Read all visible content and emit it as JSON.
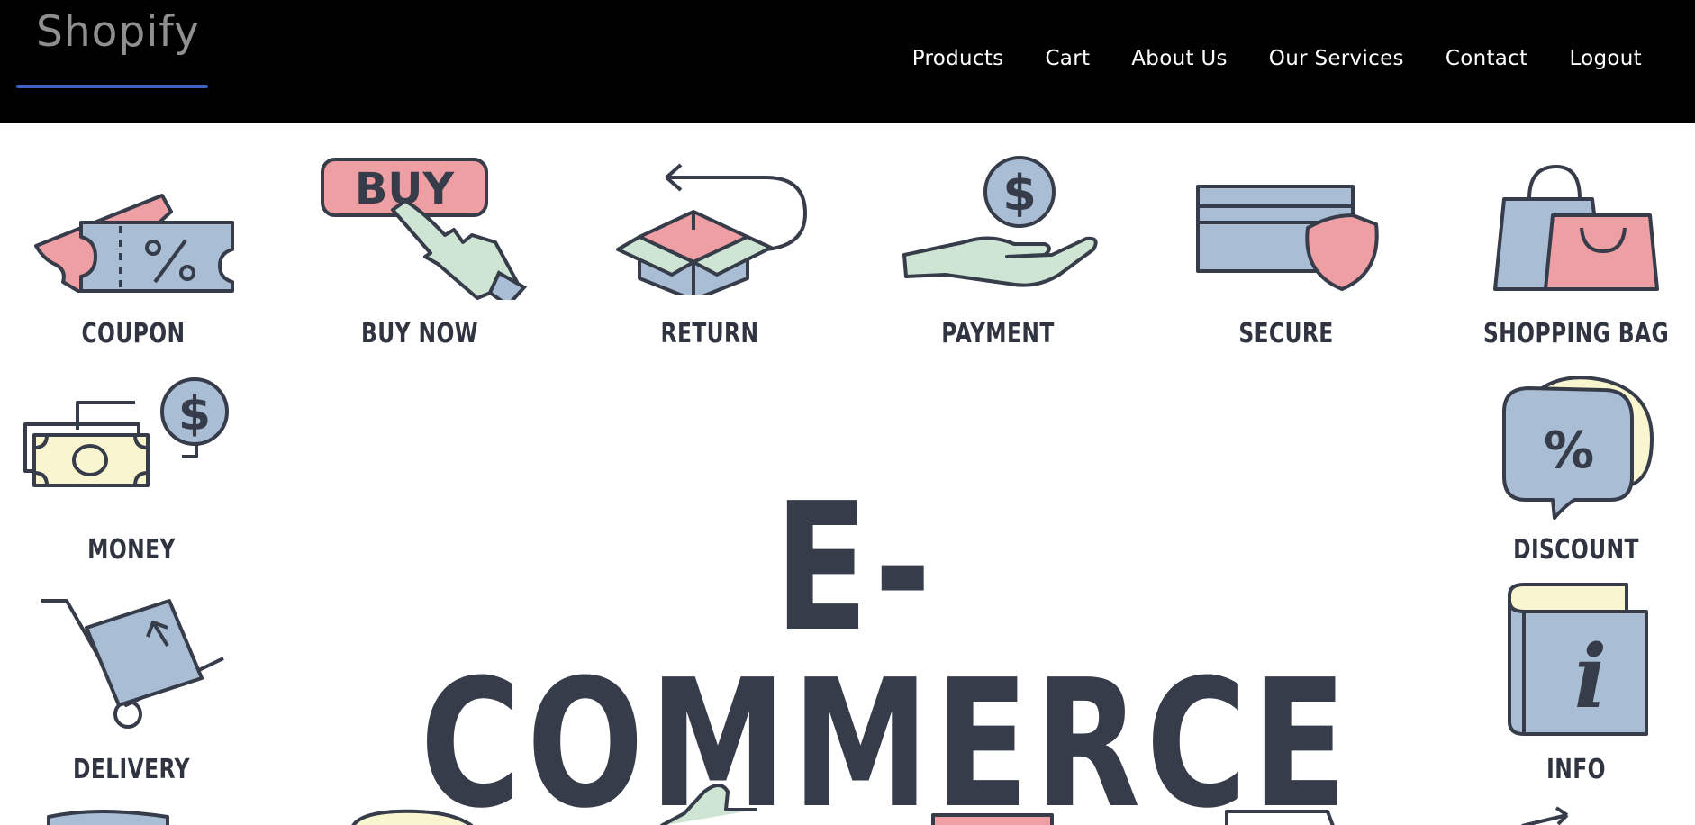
{
  "navbar": {
    "brand": "Shopify",
    "links": [
      {
        "label": "Products"
      },
      {
        "label": "Cart"
      },
      {
        "label": "About Us"
      },
      {
        "label": "Our Services"
      },
      {
        "label": "Contact"
      },
      {
        "label": "Logout"
      }
    ]
  },
  "hero": {
    "headline": "E-COMMERCE",
    "colors": {
      "ink": "#363c49",
      "blue": "#a9bdd4",
      "pink": "#ee9fa3",
      "green": "#cfe5d4",
      "cream": "#f8f5cf",
      "accent_underline": "#3f62c9"
    },
    "icons": [
      {
        "label": "COUPON",
        "icon": "coupon-icon"
      },
      {
        "label": "BUY NOW",
        "icon": "buy-now-icon",
        "button_text": "BUY"
      },
      {
        "label": "RETURN",
        "icon": "return-box-icon"
      },
      {
        "label": "PAYMENT",
        "icon": "payment-hand-icon",
        "glyph": "$"
      },
      {
        "label": "SECURE",
        "icon": "secure-card-icon"
      },
      {
        "label": "SHOPPING BAG",
        "icon": "shopping-bag-icon"
      },
      {
        "label": "MONEY",
        "icon": "money-icon",
        "glyph": "$"
      },
      {
        "label": "DISCOUNT",
        "icon": "discount-icon",
        "glyph": "%"
      },
      {
        "label": "DELIVERY",
        "icon": "delivery-cart-icon"
      },
      {
        "label": "INFO",
        "icon": "info-book-icon",
        "glyph": "i"
      }
    ]
  }
}
